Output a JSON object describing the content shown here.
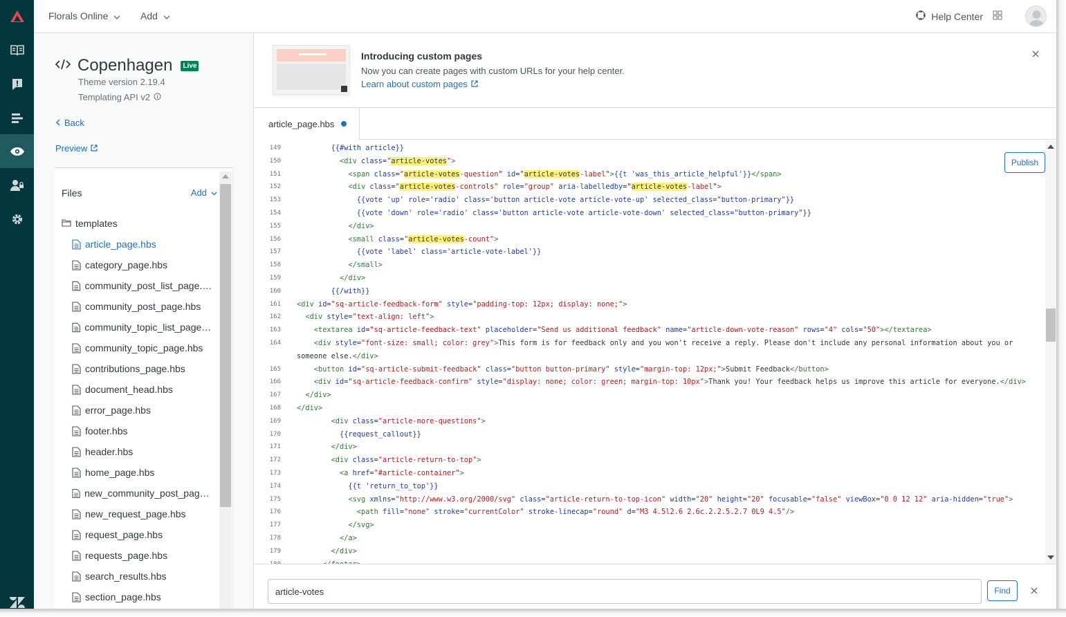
{
  "topbar": {
    "brand_menu": "Florals Online",
    "add_menu": "Add",
    "help_center": "Help Center"
  },
  "theme": {
    "name": "Copenhagen",
    "status": "Live",
    "version": "Theme version 2.19.4",
    "api": "Templating API v2",
    "back": "Back",
    "preview": "Preview"
  },
  "files": {
    "header": "Files",
    "add": "Add",
    "folder": "templates",
    "items": [
      "article_page.hbs",
      "category_page.hbs",
      "community_post_list_page.hbs",
      "community_post_page.hbs",
      "community_topic_list_page.hbs",
      "community_topic_page.hbs",
      "contributions_page.hbs",
      "document_head.hbs",
      "error_page.hbs",
      "footer.hbs",
      "header.hbs",
      "home_page.hbs",
      "new_community_post_page.hbs",
      "new_request_page.hbs",
      "request_page.hbs",
      "requests_page.hbs",
      "search_results.hbs",
      "section_page.hbs"
    ]
  },
  "banner": {
    "title": "Introducing custom pages",
    "text": "Now you can create pages with custom URLs for your help center.",
    "link": "Learn about custom pages"
  },
  "editor": {
    "tab": "article_page.hbs",
    "publish": "Publish",
    "lines": [
      {
        "n": "149",
        "s": [
          [
            "hbs",
            "        {{#with article}}"
          ]
        ]
      },
      {
        "n": "150",
        "s": [
          [
            "tag",
            "          <div "
          ],
          [
            "attr",
            "class"
          ],
          [
            "plain",
            "="
          ],
          [
            "str",
            "\""
          ],
          [
            "hl",
            "article-votes"
          ],
          [
            "str",
            "\""
          ],
          [
            "tag",
            ">"
          ]
        ]
      },
      {
        "n": "151",
        "s": [
          [
            "tag",
            "            <span "
          ],
          [
            "attr",
            "class"
          ],
          [
            "plain",
            "="
          ],
          [
            "str",
            "\""
          ],
          [
            "hl",
            "article-votes"
          ],
          [
            "str",
            "-question\" "
          ],
          [
            "attr",
            "id"
          ],
          [
            "plain",
            "="
          ],
          [
            "str",
            "\""
          ],
          [
            "hl",
            "article-votes"
          ],
          [
            "str",
            "-label\""
          ],
          [
            "tag",
            ">"
          ],
          [
            "hbs",
            "{{t 'was_this_article_helpful'}}"
          ],
          [
            "tag",
            "</span>"
          ]
        ]
      },
      {
        "n": "152",
        "s": [
          [
            "tag",
            "            <div "
          ],
          [
            "attr",
            "class"
          ],
          [
            "plain",
            "="
          ],
          [
            "str",
            "\""
          ],
          [
            "hl",
            "article-votes"
          ],
          [
            "str",
            "-controls\" "
          ],
          [
            "attr",
            "role"
          ],
          [
            "plain",
            "="
          ],
          [
            "str",
            "\"group\" "
          ],
          [
            "attr",
            "aria-labelledby"
          ],
          [
            "plain",
            "="
          ],
          [
            "str",
            "\""
          ],
          [
            "hl",
            "article-votes"
          ],
          [
            "str",
            "-label\""
          ],
          [
            "tag",
            ">"
          ]
        ]
      },
      {
        "n": "153",
        "s": [
          [
            "hbs",
            "              {{vote 'up' role='radio' class='button article-vote article-vote-up' selected_class=\"button-primary\"}}"
          ]
        ]
      },
      {
        "n": "154",
        "s": [
          [
            "hbs",
            "              {{vote 'down' role='radio' class='button article-vote article-vote-down' selected_class=\"button-primary\"}}"
          ]
        ]
      },
      {
        "n": "155",
        "s": [
          [
            "tag",
            "            </div>"
          ]
        ]
      },
      {
        "n": "156",
        "s": [
          [
            "tag",
            "            <small "
          ],
          [
            "attr",
            "class"
          ],
          [
            "plain",
            "="
          ],
          [
            "str",
            "\""
          ],
          [
            "hl",
            "article-votes"
          ],
          [
            "str",
            "-count\""
          ],
          [
            "tag",
            ">"
          ]
        ]
      },
      {
        "n": "157",
        "s": [
          [
            "hbs",
            "              {{vote 'label' class='article-vote-label'}}"
          ]
        ]
      },
      {
        "n": "158",
        "s": [
          [
            "tag",
            "            </small>"
          ]
        ]
      },
      {
        "n": "159",
        "s": [
          [
            "tag",
            "          </div>"
          ]
        ]
      },
      {
        "n": "160",
        "s": [
          [
            "hbs",
            "        {{/with}}"
          ]
        ]
      },
      {
        "n": "161",
        "s": [
          [
            "tag",
            "<div "
          ],
          [
            "attr",
            "id"
          ],
          [
            "plain",
            "="
          ],
          [
            "str",
            "\"sq-article-feedback-form\" "
          ],
          [
            "attr",
            "style"
          ],
          [
            "plain",
            "="
          ],
          [
            "str",
            "\"padding-top: 12px; display: none;\""
          ],
          [
            "tag",
            ">"
          ]
        ]
      },
      {
        "n": "162",
        "s": [
          [
            "tag",
            "  <div "
          ],
          [
            "attr",
            "style"
          ],
          [
            "plain",
            "="
          ],
          [
            "str",
            "\"text-align: left\""
          ],
          [
            "tag",
            ">"
          ]
        ]
      },
      {
        "n": "163",
        "s": [
          [
            "tag",
            "    <textarea "
          ],
          [
            "attr",
            "id"
          ],
          [
            "plain",
            "="
          ],
          [
            "str",
            "\"sq-article-feedback-text\" "
          ],
          [
            "attr",
            "placeholder"
          ],
          [
            "plain",
            "="
          ],
          [
            "str",
            "\"Send us additional feedback\" "
          ],
          [
            "attr",
            "name"
          ],
          [
            "plain",
            "="
          ],
          [
            "str",
            "\"article-down-vote-reason\" "
          ],
          [
            "attr",
            "rows"
          ],
          [
            "plain",
            "="
          ],
          [
            "str",
            "\"4\" "
          ],
          [
            "attr",
            "cols"
          ],
          [
            "plain",
            "="
          ],
          [
            "str",
            "\"50\""
          ],
          [
            "tag",
            "></textarea>"
          ]
        ]
      },
      {
        "n": "164",
        "s": [
          [
            "tag",
            "    <div "
          ],
          [
            "attr",
            "style"
          ],
          [
            "plain",
            "="
          ],
          [
            "str",
            "\"font-size: small; color: grey\""
          ],
          [
            "tag",
            ">"
          ],
          [
            "plain",
            "This form is for feedback only and you won't receive a reply. Please don't include any personal information about you or"
          ]
        ]
      },
      {
        "n": "",
        "s": [
          [
            "plain",
            "someone else."
          ],
          [
            "tag",
            "</div>"
          ]
        ]
      },
      {
        "n": "165",
        "s": [
          [
            "tag",
            "    <button "
          ],
          [
            "attr",
            "id"
          ],
          [
            "plain",
            "="
          ],
          [
            "str",
            "\"sq-article-submit-feedback\" "
          ],
          [
            "attr",
            "class"
          ],
          [
            "plain",
            "="
          ],
          [
            "str",
            "\"button button-primary\" "
          ],
          [
            "attr",
            "style"
          ],
          [
            "plain",
            "="
          ],
          [
            "str",
            "\"margin-top: 12px;\""
          ],
          [
            "tag",
            ">"
          ],
          [
            "plain",
            "Submit Feedback"
          ],
          [
            "tag",
            "</button>"
          ]
        ]
      },
      {
        "n": "166",
        "s": [
          [
            "tag",
            "    <div "
          ],
          [
            "attr",
            "id"
          ],
          [
            "plain",
            "="
          ],
          [
            "str",
            "\"sq-article-feedback-confirm\" "
          ],
          [
            "attr",
            "style"
          ],
          [
            "plain",
            "="
          ],
          [
            "str",
            "\"display: none; color: green; margin-top: 10px\""
          ],
          [
            "tag",
            ">"
          ],
          [
            "plain",
            "Thank you! Your feedback helps us improve this article for everyone."
          ],
          [
            "tag",
            "</div>"
          ]
        ]
      },
      {
        "n": "167",
        "s": [
          [
            "tag",
            "  </div>"
          ]
        ]
      },
      {
        "n": "168",
        "s": [
          [
            "tag",
            "</div>"
          ]
        ]
      },
      {
        "n": "169",
        "s": [
          [
            "tag",
            "        <div "
          ],
          [
            "attr",
            "class"
          ],
          [
            "plain",
            "="
          ],
          [
            "str",
            "\"article-more-questions\""
          ],
          [
            "tag",
            ">"
          ]
        ]
      },
      {
        "n": "170",
        "s": [
          [
            "hbs",
            "          {{request_callout}}"
          ]
        ]
      },
      {
        "n": "171",
        "s": [
          [
            "tag",
            "        </div>"
          ]
        ]
      },
      {
        "n": "172",
        "s": [
          [
            "tag",
            "        <div "
          ],
          [
            "attr",
            "class"
          ],
          [
            "plain",
            "="
          ],
          [
            "str",
            "\"article-return-to-top\""
          ],
          [
            "tag",
            ">"
          ]
        ]
      },
      {
        "n": "173",
        "s": [
          [
            "tag",
            "          <a "
          ],
          [
            "attr",
            "href"
          ],
          [
            "plain",
            "="
          ],
          [
            "str",
            "\"#article-container\""
          ],
          [
            "tag",
            ">"
          ]
        ]
      },
      {
        "n": "174",
        "s": [
          [
            "hbs",
            "            {{t 'return_to_top'}}"
          ]
        ]
      },
      {
        "n": "175",
        "s": [
          [
            "tag",
            "            <svg "
          ],
          [
            "attr",
            "xmlns"
          ],
          [
            "plain",
            "="
          ],
          [
            "str",
            "\"http://www.w3.org/2000/svg\" "
          ],
          [
            "attr",
            "class"
          ],
          [
            "plain",
            "="
          ],
          [
            "str",
            "\"article-return-to-top-icon\" "
          ],
          [
            "attr",
            "width"
          ],
          [
            "plain",
            "="
          ],
          [
            "str",
            "\"20\" "
          ],
          [
            "attr",
            "height"
          ],
          [
            "plain",
            "="
          ],
          [
            "str",
            "\"20\" "
          ],
          [
            "attr",
            "focusable"
          ],
          [
            "plain",
            "="
          ],
          [
            "str",
            "\"false\" "
          ],
          [
            "attr",
            "viewBox"
          ],
          [
            "plain",
            "="
          ],
          [
            "str",
            "\"0 0 12 12\" "
          ],
          [
            "attr",
            "aria-hidden"
          ],
          [
            "plain",
            "="
          ],
          [
            "str",
            "\"true\""
          ],
          [
            "tag",
            ">"
          ]
        ]
      },
      {
        "n": "176",
        "s": [
          [
            "tag",
            "              <path "
          ],
          [
            "attr",
            "fill"
          ],
          [
            "plain",
            "="
          ],
          [
            "str",
            "\"none\" "
          ],
          [
            "attr",
            "stroke"
          ],
          [
            "plain",
            "="
          ],
          [
            "str",
            "\"currentColor\" "
          ],
          [
            "attr",
            "stroke-linecap"
          ],
          [
            "plain",
            "="
          ],
          [
            "str",
            "\"round\" "
          ],
          [
            "attr",
            "d"
          ],
          [
            "plain",
            "="
          ],
          [
            "str",
            "\"M3 4.5l2.6 2.6c.2.2.5.2.7 0L9 4.5\""
          ],
          [
            "tag",
            "/>"
          ]
        ]
      },
      {
        "n": "177",
        "s": [
          [
            "tag",
            "            </svg>"
          ]
        ]
      },
      {
        "n": "178",
        "s": [
          [
            "tag",
            "          </a>"
          ]
        ]
      },
      {
        "n": "179",
        "s": [
          [
            "tag",
            "        </div>"
          ]
        ]
      },
      {
        "n": "180",
        "s": [
          [
            "tag",
            "      </footer>"
          ]
        ]
      }
    ]
  },
  "find": {
    "value": "article-votes",
    "button": "Find"
  },
  "colors": {
    "rail": "#03363d",
    "accent": "#1f73b7",
    "live": "#038153",
    "highlight": "#fff176"
  }
}
